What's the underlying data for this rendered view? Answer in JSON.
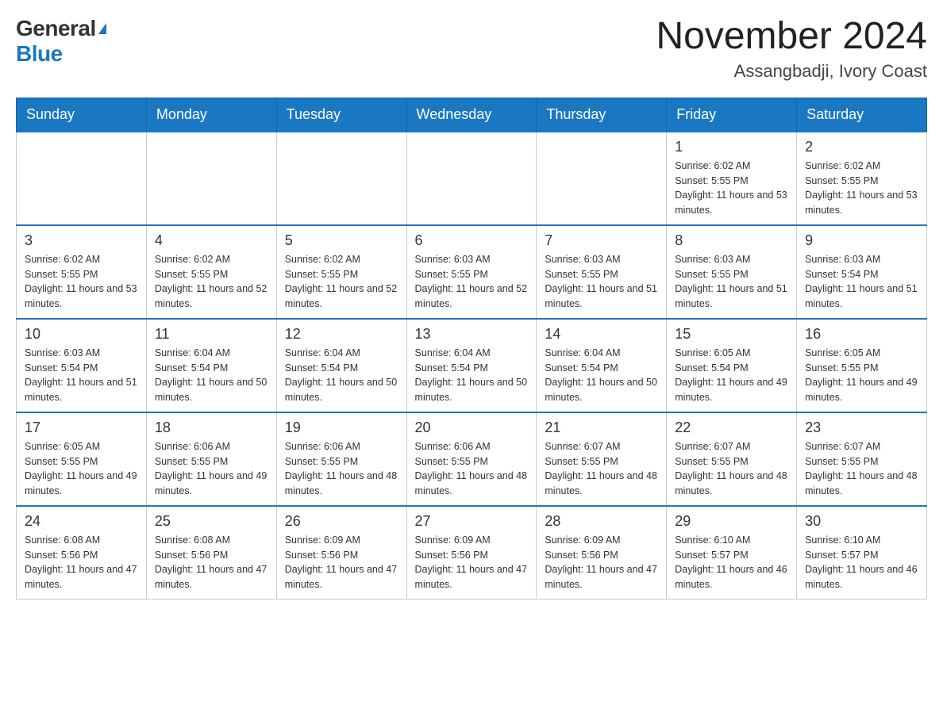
{
  "header": {
    "logo_general": "General",
    "logo_blue": "Blue",
    "title": "November 2024",
    "subtitle": "Assangbadji, Ivory Coast"
  },
  "weekdays": [
    "Sunday",
    "Monday",
    "Tuesday",
    "Wednesday",
    "Thursday",
    "Friday",
    "Saturday"
  ],
  "weeks": [
    {
      "days": [
        {
          "number": "",
          "info": "",
          "empty": true
        },
        {
          "number": "",
          "info": "",
          "empty": true
        },
        {
          "number": "",
          "info": "",
          "empty": true
        },
        {
          "number": "",
          "info": "",
          "empty": true
        },
        {
          "number": "",
          "info": "",
          "empty": true
        },
        {
          "number": "1",
          "info": "Sunrise: 6:02 AM\nSunset: 5:55 PM\nDaylight: 11 hours and 53 minutes."
        },
        {
          "number": "2",
          "info": "Sunrise: 6:02 AM\nSunset: 5:55 PM\nDaylight: 11 hours and 53 minutes."
        }
      ]
    },
    {
      "days": [
        {
          "number": "3",
          "info": "Sunrise: 6:02 AM\nSunset: 5:55 PM\nDaylight: 11 hours and 53 minutes."
        },
        {
          "number": "4",
          "info": "Sunrise: 6:02 AM\nSunset: 5:55 PM\nDaylight: 11 hours and 52 minutes."
        },
        {
          "number": "5",
          "info": "Sunrise: 6:02 AM\nSunset: 5:55 PM\nDaylight: 11 hours and 52 minutes."
        },
        {
          "number": "6",
          "info": "Sunrise: 6:03 AM\nSunset: 5:55 PM\nDaylight: 11 hours and 52 minutes."
        },
        {
          "number": "7",
          "info": "Sunrise: 6:03 AM\nSunset: 5:55 PM\nDaylight: 11 hours and 51 minutes."
        },
        {
          "number": "8",
          "info": "Sunrise: 6:03 AM\nSunset: 5:55 PM\nDaylight: 11 hours and 51 minutes."
        },
        {
          "number": "9",
          "info": "Sunrise: 6:03 AM\nSunset: 5:54 PM\nDaylight: 11 hours and 51 minutes."
        }
      ]
    },
    {
      "days": [
        {
          "number": "10",
          "info": "Sunrise: 6:03 AM\nSunset: 5:54 PM\nDaylight: 11 hours and 51 minutes."
        },
        {
          "number": "11",
          "info": "Sunrise: 6:04 AM\nSunset: 5:54 PM\nDaylight: 11 hours and 50 minutes."
        },
        {
          "number": "12",
          "info": "Sunrise: 6:04 AM\nSunset: 5:54 PM\nDaylight: 11 hours and 50 minutes."
        },
        {
          "number": "13",
          "info": "Sunrise: 6:04 AM\nSunset: 5:54 PM\nDaylight: 11 hours and 50 minutes."
        },
        {
          "number": "14",
          "info": "Sunrise: 6:04 AM\nSunset: 5:54 PM\nDaylight: 11 hours and 50 minutes."
        },
        {
          "number": "15",
          "info": "Sunrise: 6:05 AM\nSunset: 5:54 PM\nDaylight: 11 hours and 49 minutes."
        },
        {
          "number": "16",
          "info": "Sunrise: 6:05 AM\nSunset: 5:55 PM\nDaylight: 11 hours and 49 minutes."
        }
      ]
    },
    {
      "days": [
        {
          "number": "17",
          "info": "Sunrise: 6:05 AM\nSunset: 5:55 PM\nDaylight: 11 hours and 49 minutes."
        },
        {
          "number": "18",
          "info": "Sunrise: 6:06 AM\nSunset: 5:55 PM\nDaylight: 11 hours and 49 minutes."
        },
        {
          "number": "19",
          "info": "Sunrise: 6:06 AM\nSunset: 5:55 PM\nDaylight: 11 hours and 48 minutes."
        },
        {
          "number": "20",
          "info": "Sunrise: 6:06 AM\nSunset: 5:55 PM\nDaylight: 11 hours and 48 minutes."
        },
        {
          "number": "21",
          "info": "Sunrise: 6:07 AM\nSunset: 5:55 PM\nDaylight: 11 hours and 48 minutes."
        },
        {
          "number": "22",
          "info": "Sunrise: 6:07 AM\nSunset: 5:55 PM\nDaylight: 11 hours and 48 minutes."
        },
        {
          "number": "23",
          "info": "Sunrise: 6:07 AM\nSunset: 5:55 PM\nDaylight: 11 hours and 48 minutes."
        }
      ]
    },
    {
      "days": [
        {
          "number": "24",
          "info": "Sunrise: 6:08 AM\nSunset: 5:56 PM\nDaylight: 11 hours and 47 minutes."
        },
        {
          "number": "25",
          "info": "Sunrise: 6:08 AM\nSunset: 5:56 PM\nDaylight: 11 hours and 47 minutes."
        },
        {
          "number": "26",
          "info": "Sunrise: 6:09 AM\nSunset: 5:56 PM\nDaylight: 11 hours and 47 minutes."
        },
        {
          "number": "27",
          "info": "Sunrise: 6:09 AM\nSunset: 5:56 PM\nDaylight: 11 hours and 47 minutes."
        },
        {
          "number": "28",
          "info": "Sunrise: 6:09 AM\nSunset: 5:56 PM\nDaylight: 11 hours and 47 minutes."
        },
        {
          "number": "29",
          "info": "Sunrise: 6:10 AM\nSunset: 5:57 PM\nDaylight: 11 hours and 46 minutes."
        },
        {
          "number": "30",
          "info": "Sunrise: 6:10 AM\nSunset: 5:57 PM\nDaylight: 11 hours and 46 minutes."
        }
      ]
    }
  ]
}
